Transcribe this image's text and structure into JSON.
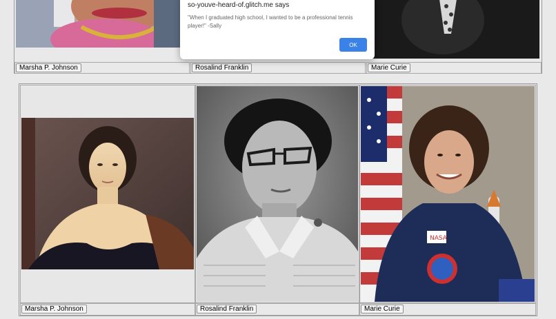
{
  "alert": {
    "title": "so-youve-heard-of.glitch.me says",
    "message": "\"When I graduated high school, I wanted to be a professional tennis player!\" -Sally",
    "ok_label": "OK"
  },
  "top_round": {
    "buttons": [
      "Marsha P. Johnson",
      "Rosalind Franklin",
      "Marie Curie"
    ]
  },
  "bottom_round": {
    "buttons": [
      "Marsha P. Johnson",
      "Rosalind Franklin",
      "Marie Curie"
    ]
  }
}
